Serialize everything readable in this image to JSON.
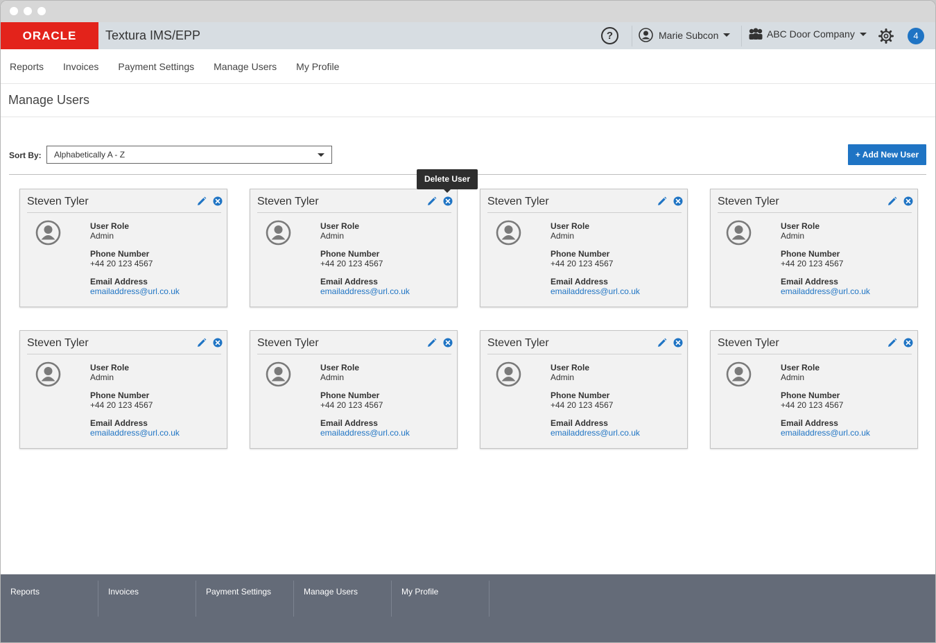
{
  "window": {
    "traffic_lights": [
      "close",
      "minimize",
      "maximize"
    ]
  },
  "appbar": {
    "logo_text": "ORACLE",
    "product_name": "Textura IMS/EPP",
    "help_label": "?",
    "user_name": "Marie Subcon",
    "company_name": "ABC Door Company",
    "notification_count": "4"
  },
  "nav": {
    "items": [
      "Reports",
      "Invoices",
      "Payment Settings",
      "Manage Users",
      "My Profile"
    ]
  },
  "page": {
    "title": "Manage Users"
  },
  "toolbar": {
    "sort_label": "Sort By:",
    "sort_value": "Alphabetically A - Z",
    "add_button": "+ Add New User"
  },
  "tooltip": {
    "text": "Delete User"
  },
  "field_labels": {
    "role": "User Role",
    "phone": "Phone Number",
    "email": "Email Address"
  },
  "users": [
    {
      "name": "Steven Tyler",
      "role": "Admin",
      "phone": "+44 20 123 4567",
      "email": "emailaddress@url.co.uk"
    },
    {
      "name": "Steven Tyler",
      "role": "Admin",
      "phone": "+44 20 123 4567",
      "email": "emailaddress@url.co.uk"
    },
    {
      "name": "Steven Tyler",
      "role": "Admin",
      "phone": "+44 20 123 4567",
      "email": "emailaddress@url.co.uk"
    },
    {
      "name": "Steven Tyler",
      "role": "Admin",
      "phone": "+44 20 123 4567",
      "email": "emailaddress@url.co.uk"
    },
    {
      "name": "Steven Tyler",
      "role": "Admin",
      "phone": "+44 20 123 4567",
      "email": "emailaddress@url.co.uk"
    },
    {
      "name": "Steven Tyler",
      "role": "Admin",
      "phone": "+44 20 123 4567",
      "email": "emailaddress@url.co.uk"
    },
    {
      "name": "Steven Tyler",
      "role": "Admin",
      "phone": "+44 20 123 4567",
      "email": "emailaddress@url.co.uk"
    },
    {
      "name": "Steven Tyler",
      "role": "Admin",
      "phone": "+44 20 123 4567",
      "email": "emailaddress@url.co.uk"
    }
  ],
  "footer": {
    "items": [
      "Reports",
      "Invoices",
      "Payment Settings",
      "Manage Users",
      "My Profile"
    ]
  },
  "colors": {
    "brand_red": "#e3231b",
    "accent_blue": "#1f74c4",
    "footer_bg": "#646b78"
  }
}
